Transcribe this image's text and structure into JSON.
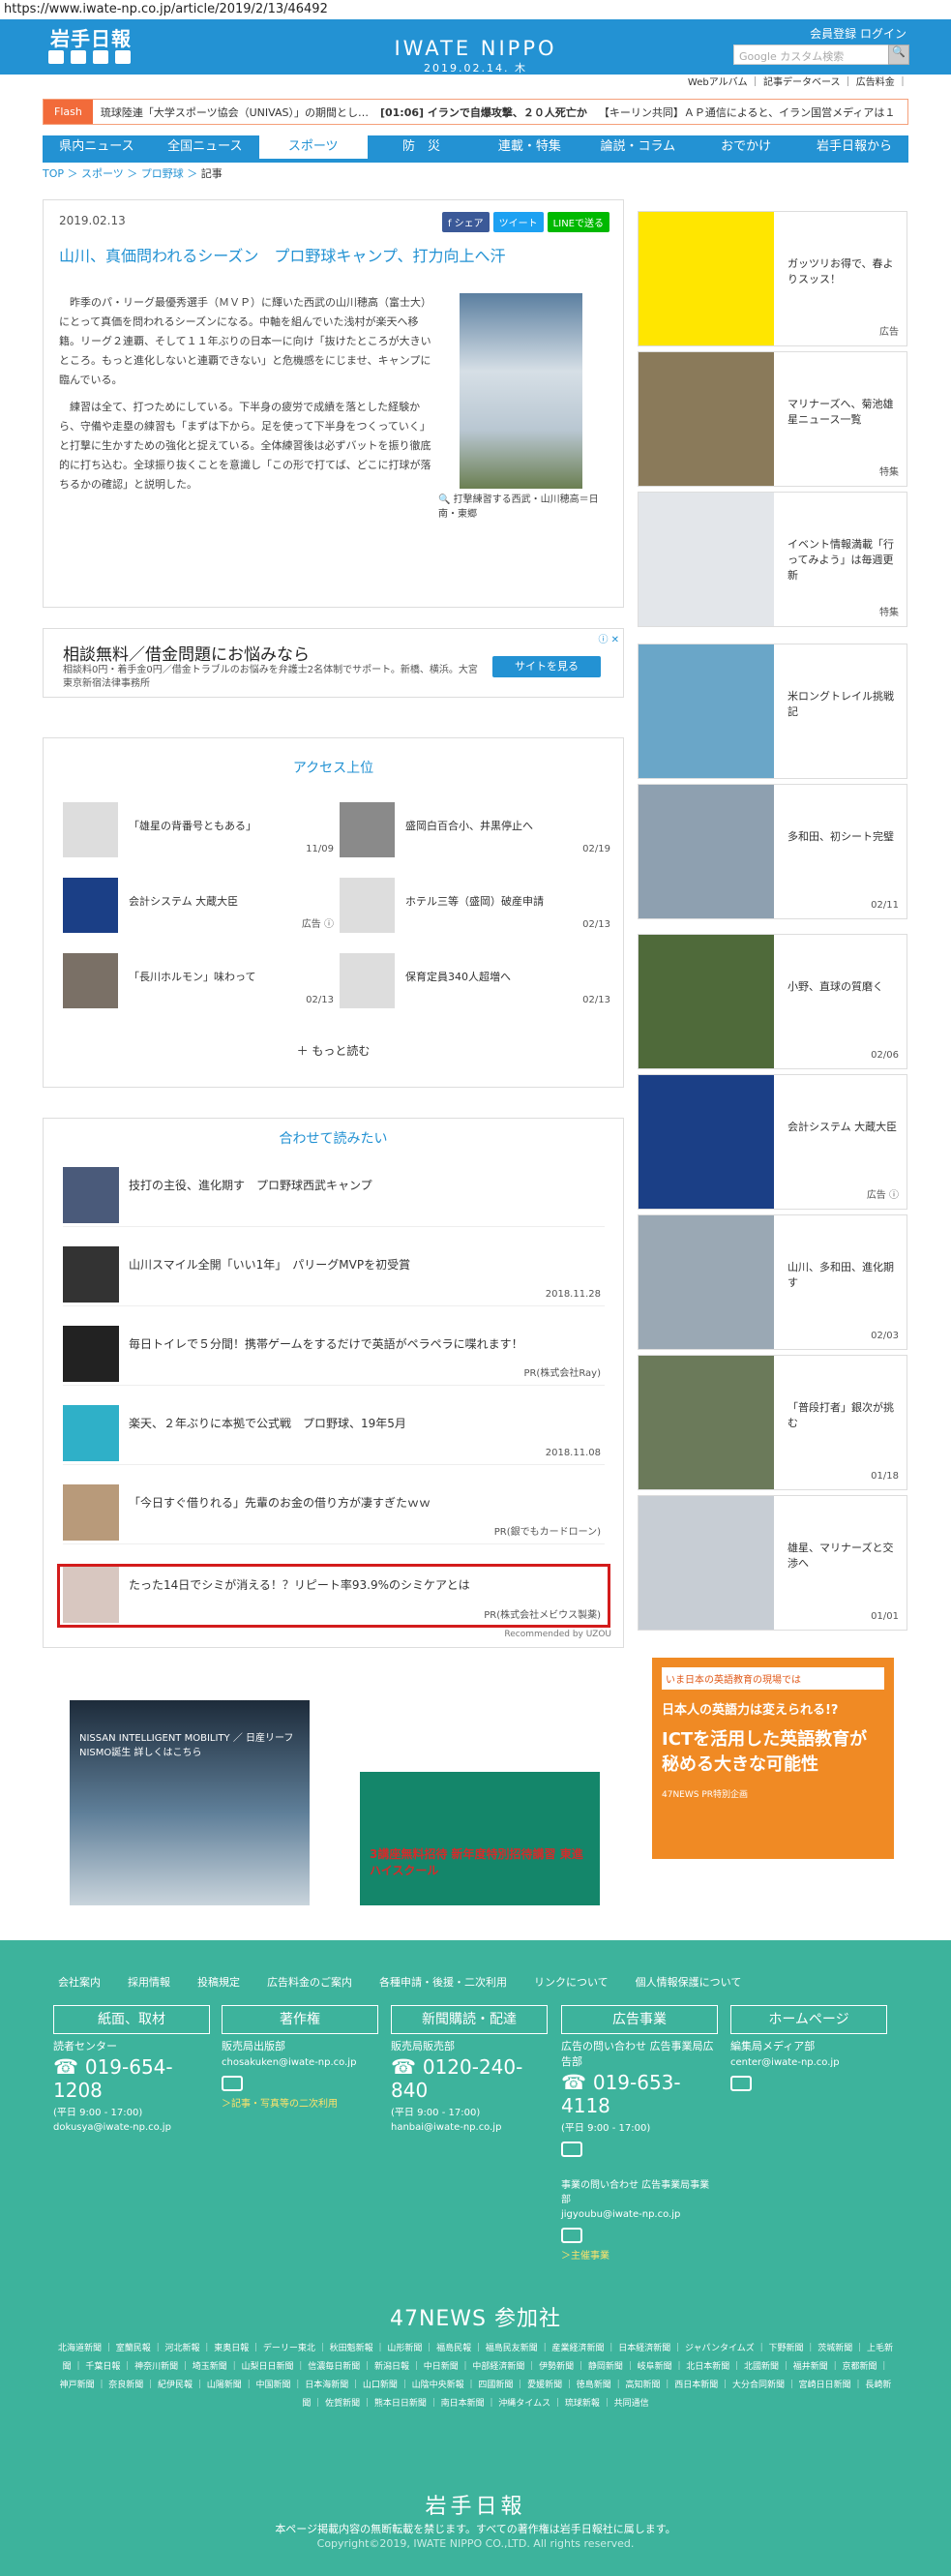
{
  "url": "https://www.iwate-np.co.jp/article/2019/2/13/46492",
  "header": {
    "logo": "岩手日報",
    "brand": "IWATE NIPPO",
    "date": "2019.02.14. 木",
    "links": "会員登録 ログイン",
    "search_placeholder": "Google カスタム検索",
    "search_button": "🔍"
  },
  "sublinks": "Webアルバム ｜ 記事データベース ｜ 広告料金 ｜",
  "flash": {
    "label": "Flash",
    "items": [
      "琉球陸連「大学スポーツ協会（UNIVAS）」の期間とし…",
      "[01:06] イランで自爆攻撃、２０人死亡か",
      "【キーリン共同】ＡＰ通信によると、イラン国営メディアは１"
    ]
  },
  "nav": [
    "県内ニュース",
    "全国ニュース",
    "スポーツ",
    "防　災",
    "連載・特集",
    "論説・コラム",
    "おでかけ",
    "岩手日報から"
  ],
  "crumb": {
    "top": "TOP",
    "sports": "スポーツ",
    "pro": "プロ野球",
    "cur": "記事",
    "sep": " ＞ "
  },
  "article": {
    "date": "2019.02.13",
    "share": "f シェア",
    "tweet": "ツイート",
    "line": "LINEで送る",
    "title": "山川、真価問われるシーズン　プロ野球キャンプ、打力向上へ汗",
    "p1": "昨季のパ・リーグ最優秀選手（ＭＶＰ）に輝いた西武の山川穂高（富士大）にとって真価を問われるシーズンになる。中軸を組んでいた浅村が楽天へ移籍。リーグ２連覇、そして１１年ぶりの日本一に向け「抜けたところが大きいところ。もっと進化しないと連覇できない」と危機感をにじませ、キャンプに臨んでいる。",
    "p2": "練習は全て、打つためにしている。下半身の疲労で成績を落とした経験から、守備や走塁の練習も「まずは下から。足を使って下半身をつくっていく」と打撃に生かすための強化と捉えている。全体練習後は必ずバットを振り徹底的に打ち込む。全球振り抜くことを意識し「この形で打てば、どこに打球が落ちるかの確認」と説明した。",
    "caption": "🔍 打撃練習する西武・山川穂高＝日南・東郷"
  },
  "ad": {
    "title": "相談無料／借金問題にお悩みなら",
    "desc": "相談料0円・着手金0円／借金トラブルのお悩みを弁護士2名体制でサポート。新橋、横浜。大宮 東京新宿法律事務所",
    "button": "サイトを見る",
    "x": "ⓘ ✕"
  },
  "ranking": {
    "heading": "アクセス上位",
    "more": "＋ もっと読む",
    "items": [
      {
        "title": "「雄星の背番号ともある」",
        "date": "11/09"
      },
      {
        "title": "盛岡白百合小、井黒停止へ",
        "date": "02/19"
      },
      {
        "title": "会計システム 大蔵大臣",
        "date": "広告 ⓘ"
      },
      {
        "title": "ホテル三等（盛岡）破産申請",
        "date": "02/13"
      },
      {
        "title": "「長川ホルモン」味わって",
        "date": "02/13"
      },
      {
        "title": "保育定員340人超増へ",
        "date": "02/13"
      }
    ]
  },
  "related": {
    "heading": "合わせて読みたい",
    "items": [
      {
        "title": "技打の主役、進化期す　プロ野球西武キャンプ",
        "date": ""
      },
      {
        "title": "山川スマイル全開「いい1年」　パリーグMVPを初受賞",
        "date": "2018.11.28"
      },
      {
        "title": "毎日トイレで５分間！携帯ゲームをするだけで英語がペラペラに喋れます！",
        "date": "PR(株式会社Ray)"
      },
      {
        "title": "楽天、２年ぶりに本拠で公式戦　プロ野球、19年5月",
        "date": "2018.11.08"
      },
      {
        "title": "「今日すぐ借りれる」先輩のお金の借り方が凄すぎたｗｗ",
        "date": "PR(銀でもカードローン)"
      },
      {
        "title": "たった14日でシミが消える！？リピート率93.9%のシミケアとは",
        "date": "PR(株式会社メビウス製薬)"
      }
    ],
    "reco": "Recommended by UZOU"
  },
  "bottom_ads": [
    "NISSAN INTELLIGENT MOBILITY ／ 日産リーフ NISMO誕生 詳しくはこちら",
    "3講座無料招待 新年度特別招待講習 東進ハイスクール"
  ],
  "sidebar": [
    {
      "title": "ガッツリお得で、春よりスッス！",
      "date": "広告"
    },
    {
      "title": "マリナーズへ、菊池雄星ニュース一覧",
      "date": "特集"
    },
    {
      "title": "イベント情報満載「行ってみよう」は毎週更新",
      "date": "特集"
    },
    {
      "title": "米ロングトレイル挑戦記",
      "date": ""
    },
    {
      "title": "多和田、初シート完璧",
      "date": "02/11"
    },
    {
      "title": "小野、直球の質磨く",
      "date": "02/06"
    },
    {
      "title": "会計システム 大蔵大臣",
      "date": "広告 ⓘ"
    },
    {
      "title": "山川、多和田、進化期す",
      "date": "02/03"
    },
    {
      "title": "「普段打者」銀次が挑む",
      "date": "01/18"
    },
    {
      "title": "雄星、マリナーズと交渉へ",
      "date": "01/01"
    }
  ],
  "side_ad": {
    "top": "いま日本の英語教育の現場では",
    "title": "日本人の英語力は変えられる!?",
    "big": "ICTを活用した英語教育が秘める大きな可能性",
    "foot": "47NEWS PR特別企画"
  },
  "footer": {
    "links": [
      "会社案内",
      "採用情報",
      "投稿規定",
      "広告料金のご案内",
      "各種申請・後援・二次利用",
      "リンクについて",
      "個人情報保護について"
    ],
    "cols": [
      {
        "head": "紙面、取材",
        "sub": "読者センター",
        "tel": "019-654-1208",
        "hours": "(平日 9:00 - 17:00)",
        "mail": "dokusya@iwate-np.co.jp",
        "extra": ""
      },
      {
        "head": "著作権",
        "sub": "販売局出版部",
        "tel": "",
        "hours": "",
        "mail": "chosakuken@iwate-np.co.jp",
        "extra": "＞記事・写真等の二次利用"
      },
      {
        "head": "新聞購読・配達",
        "sub": "販売局販売部",
        "tel": "0120-240-840",
        "hours": "(平日 9:00 - 17:00)",
        "mail": "hanbai@iwate-np.co.jp",
        "extra": ""
      },
      {
        "head": "広告事業",
        "sub": "広告の問い合わせ 広告事業局広告部",
        "tel": "019-653-4118",
        "hours": "(平日 9:00 - 17:00)",
        "mail": "事業の問い合わせ 広告事業局事業部",
        "extra": "jigyoubu@iwate-np.co.jp"
      },
      {
        "head": "ホームページ",
        "sub": "編集局メディア部",
        "tel": "",
        "hours": "",
        "mail": "center@iwate-np.co.jp",
        "extra": ""
      }
    ],
    "kousen": "＞主催事業",
    "news47": "47NEWS 参加社",
    "papers": "北海道新聞 ｜ 室蘭民報 ｜ 河北新報 ｜ 東奥日報 ｜ デーリー東北 ｜ 秋田魁新報 ｜ 山形新聞 ｜ 福島民報 ｜ 福島民友新聞 ｜ 産業経済新聞 ｜ 日本経済新聞 ｜ ジャパンタイムズ ｜ 下野新聞 ｜ 茨城新聞 ｜ 上毛新聞 ｜ 千葉日報 ｜ 神奈川新聞 ｜ 埼玉新聞 ｜ 山梨日日新聞 ｜ 信濃毎日新聞 ｜ 新潟日報 ｜ 中日新聞 ｜ 中部経済新聞 ｜ 伊勢新聞 ｜ 静岡新聞 ｜ 岐阜新聞 ｜ 北日本新聞 ｜ 北國新聞 ｜ 福井新聞 ｜ 京都新聞 ｜ 神戸新聞 ｜ 奈良新聞 ｜ 紀伊民報 ｜ 山陽新聞 ｜ 中国新聞 ｜ 日本海新聞 ｜ 山口新聞 ｜ 山陰中央新報 ｜ 四國新聞 ｜ 愛媛新聞 ｜ 徳島新聞 ｜ 高知新聞 ｜ 西日本新聞 ｜ 大分合同新聞 ｜ 宮崎日日新聞 ｜ 長崎新聞 ｜ 佐賀新聞 ｜ 熊本日日新聞 ｜ 南日本新聞 ｜ 沖縄タイムス ｜ 琉球新報 ｜ 共同通信",
    "logo": "岩手日報",
    "c1": "本ページ掲載内容の無断転載を禁じます。すべての著作権は岩手日報社に属します。",
    "c2": "Copyright©2019, IWATE NIPPO CO.,LTD. All rights reserved."
  }
}
